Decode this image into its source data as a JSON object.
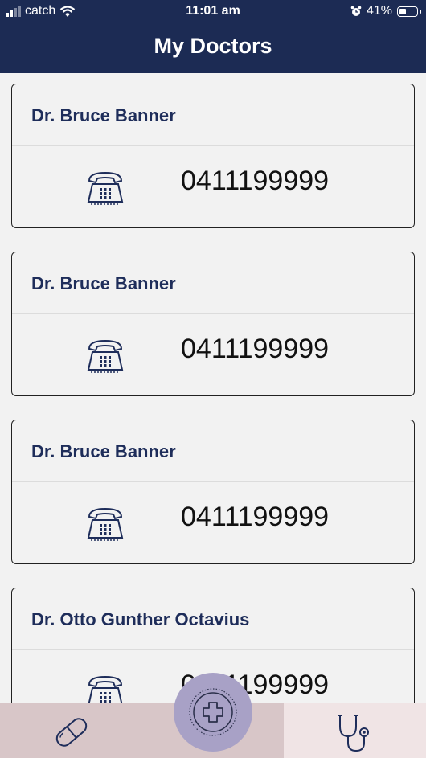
{
  "status_bar": {
    "carrier": "catch",
    "time": "11:01 am",
    "battery_percent": "41%"
  },
  "header": {
    "title": "My Doctors"
  },
  "doctors": [
    {
      "name": "Dr. Bruce Banner",
      "phone": "0411199999"
    },
    {
      "name": "Dr. Bruce Banner",
      "phone": "0411199999"
    },
    {
      "name": "Dr. Bruce Banner",
      "phone": "0411199999"
    },
    {
      "name": "Dr. Otto Gunther Octavius",
      "phone": "0411199999"
    }
  ],
  "icons": {
    "phone": "telephone-icon",
    "left_tab": "pill-icon",
    "fab": "add-plus-icon",
    "right_tab": "stethoscope-icon"
  },
  "colors": {
    "header_bg": "#1c2b54",
    "name_text": "#1e2d5a",
    "left_tab_bg": "#d8c6c8",
    "right_tab_bg": "#f0e4e5",
    "fab_bg": "#a8a1c6"
  }
}
